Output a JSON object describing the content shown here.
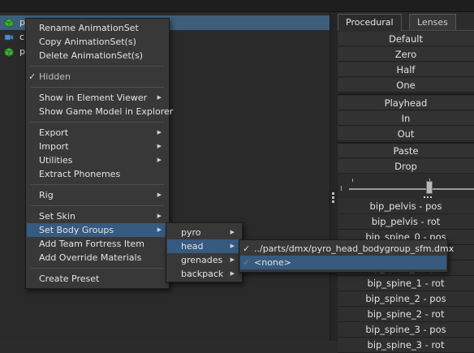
{
  "tree": {
    "rows": [
      {
        "label": "p",
        "icon": "green-cube-icon"
      },
      {
        "label": "c",
        "icon": "camera-icon"
      },
      {
        "label": "p",
        "icon": "green-cube-icon"
      }
    ]
  },
  "panel": {
    "tabs": [
      "Procedural",
      "Lenses"
    ],
    "presets": [
      "Default",
      "Zero",
      "Half",
      "One"
    ],
    "playhead": [
      "Playhead",
      "In",
      "Out"
    ],
    "clipboard": [
      "Paste",
      "Drop"
    ],
    "slider_value": 0.7,
    "controls": [
      "bip_pelvis - pos",
      "bip_pelvis - rot",
      "bip_spine_0 - pos",
      "bip_spine_0 - rot",
      "bip_spine_0 - pos",
      "bip_spine_1 - rot",
      "bip_spine_2 - pos",
      "bip_spine_2 - rot",
      "bip_spine_3 - pos",
      "bip_spine_3 - rot"
    ]
  },
  "context_menu": {
    "rename": "Rename AnimationSet",
    "copy": "Copy AnimationSet(s)",
    "delete": "Delete AnimationSet(s)",
    "hidden": "Hidden",
    "show_element_viewer": "Show in Element Viewer",
    "show_explorer": "Show Game Model in Explorer",
    "export": "Export",
    "import": "Import",
    "utilities": "Utilities",
    "extract_phonemes": "Extract Phonemes",
    "rig": "Rig",
    "set_skin": "Set Skin",
    "set_body_groups": "Set Body Groups",
    "add_tf_item": "Add Team Fortress Item",
    "add_override": "Add Override Materials",
    "create_preset": "Create Preset"
  },
  "body_groups_menu": {
    "items": [
      "pyro",
      "head",
      "grenades",
      "backpack"
    ]
  },
  "head_menu": {
    "items": [
      "../parts/dmx/pyro_head_bodygroup_sfm.dmx",
      "<none>"
    ]
  },
  "colors": {
    "highlight": "#365a80",
    "selection": "#3d5f7c",
    "menu_bg": "#383838"
  }
}
